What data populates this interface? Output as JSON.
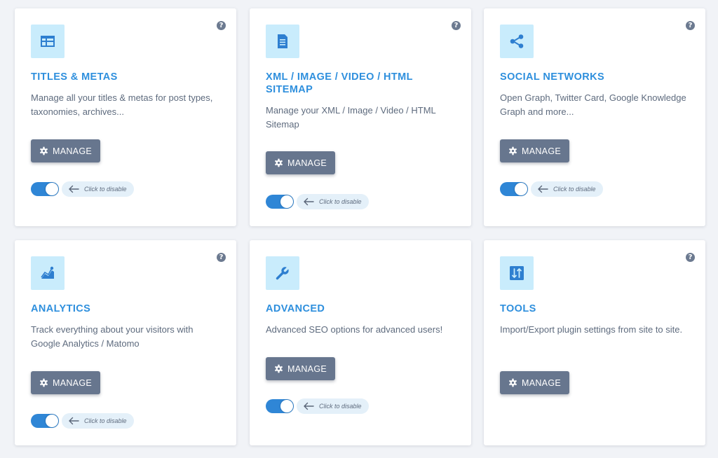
{
  "help_label": "?",
  "colors": {
    "accent": "#2e8fdd",
    "icon_bg": "#c9ecfc",
    "button": "#67768e",
    "toggle_on": "#2f86d6",
    "page_bg": "#f1f3f7"
  },
  "cards": [
    {
      "icon": "table-icon",
      "title": "TITLES & METAS",
      "description": "Manage all your titles & metas for post types, taxonomies, archives...",
      "manage_label": "MANAGE",
      "toggle_enabled": true,
      "toggle_hint": "Click to disable"
    },
    {
      "icon": "document-icon",
      "title": "XML / IMAGE / VIDEO / HTML SITEMAP",
      "description": "Manage your XML / Image / Video / HTML Sitemap",
      "manage_label": "MANAGE",
      "toggle_enabled": true,
      "toggle_hint": "Click to disable"
    },
    {
      "icon": "share-icon",
      "title": "SOCIAL NETWORKS",
      "description": "Open Graph, Twitter Card, Google Knowledge Graph and more...",
      "manage_label": "MANAGE",
      "toggle_enabled": true,
      "toggle_hint": "Click to disable"
    },
    {
      "icon": "analytics-chart-icon",
      "title": "ANALYTICS",
      "description": "Track everything about your visitors with Google Analytics / Matomo",
      "manage_label": "MANAGE",
      "toggle_enabled": true,
      "toggle_hint": "Click to disable"
    },
    {
      "icon": "wrench-icon",
      "title": "ADVANCED",
      "description": "Advanced SEO options for advanced users!",
      "manage_label": "MANAGE",
      "toggle_enabled": true,
      "toggle_hint": "Click to disable"
    },
    {
      "icon": "sort-arrows-icon",
      "title": "TOOLS",
      "description": "Import/Export plugin settings from site to site.",
      "manage_label": "MANAGE"
    }
  ]
}
